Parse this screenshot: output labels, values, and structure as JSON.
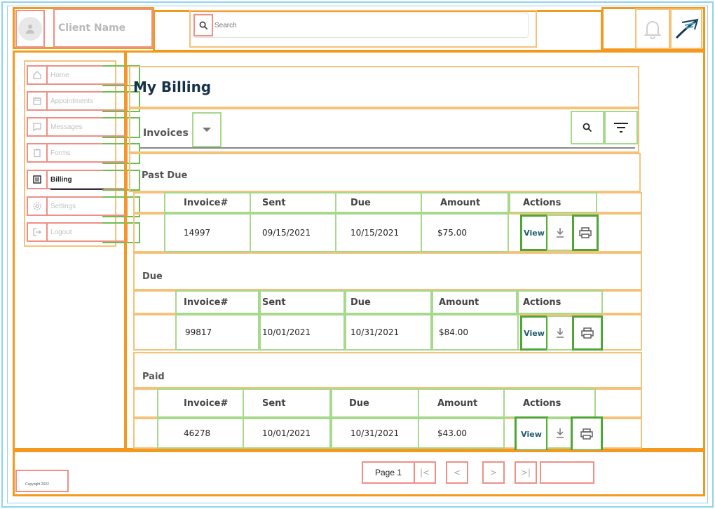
{
  "header": {
    "client_name": "Client Name",
    "search_placeholder": "Search"
  },
  "sidebar": {
    "items": [
      {
        "label": "Home",
        "icon": "home-icon"
      },
      {
        "label": "Appointments",
        "icon": "calendar-icon"
      },
      {
        "label": "Messages",
        "icon": "message-icon"
      },
      {
        "label": "Forms",
        "icon": "clipboard-icon"
      },
      {
        "label": "Billing",
        "icon": "billing-icon",
        "active": true
      },
      {
        "label": "Settings",
        "icon": "gear-icon"
      },
      {
        "label": "Logout",
        "icon": "logout-icon"
      }
    ]
  },
  "main": {
    "title": "My Billing",
    "tab_label": "Invoices",
    "columns": [
      "Invoice#",
      "Sent",
      "Due",
      "Amount",
      "Actions"
    ],
    "view_label": "View",
    "sections": [
      {
        "title": "Past Due",
        "row": {
          "invoice": "14997",
          "sent": "09/15/2021",
          "due": "10/15/2021",
          "amount": "$75.00"
        }
      },
      {
        "title": "Due",
        "row": {
          "invoice": "99817",
          "sent": "10/01/2021",
          "due": "10/31/2021",
          "amount": "$84.00"
        }
      },
      {
        "title": "Paid",
        "row": {
          "invoice": "46278",
          "sent": "10/01/2021",
          "due": "10/31/2021",
          "amount": "$43.00"
        }
      }
    ]
  },
  "footer": {
    "copyright": "Copyright 2022",
    "page_label": "Page 1",
    "first_label": "|<",
    "prev_label": "<",
    "next_label": ">",
    "last_label": ">|"
  },
  "colors": {
    "accent_orange": "#f39a1e",
    "title_navy": "#16324a",
    "view_teal": "#1b5a6e"
  }
}
